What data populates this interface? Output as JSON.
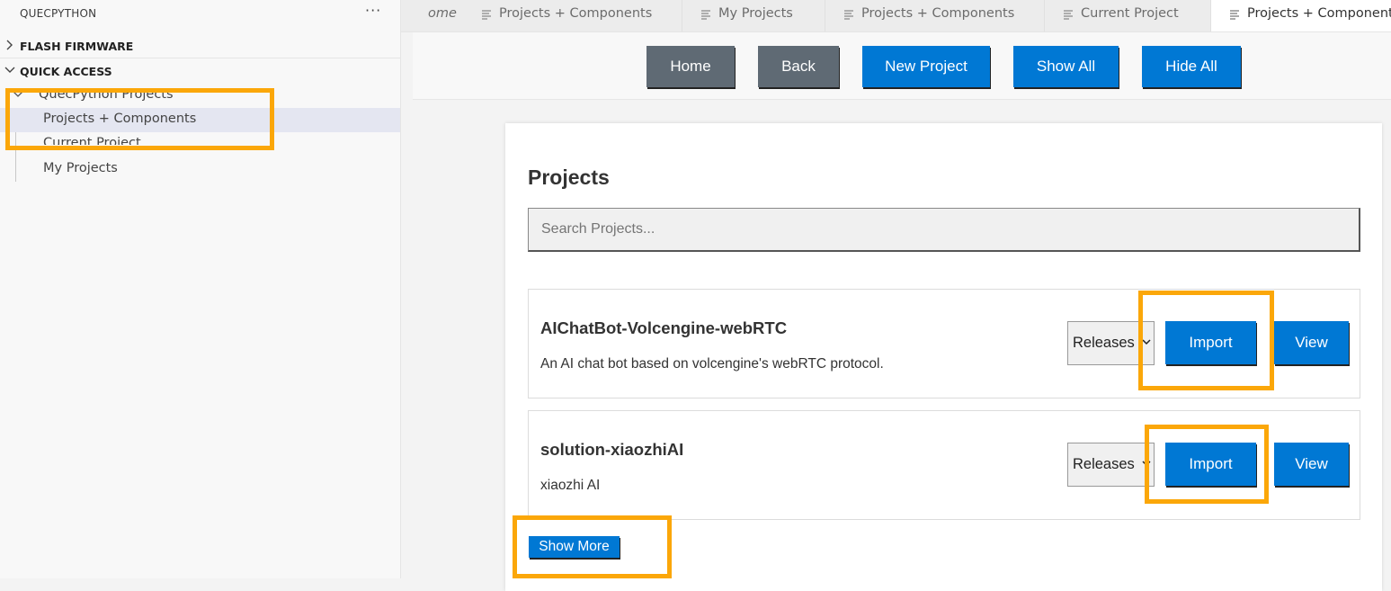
{
  "sidebar": {
    "title": "QUECPYTHON",
    "more": "···",
    "sections": [
      {
        "label": "FLASH FIRMWARE",
        "expanded": false
      },
      {
        "label": "QUICK ACCESS",
        "expanded": true
      }
    ],
    "tree": {
      "group": "QuecPython Projects",
      "items": [
        {
          "label": "Projects + Components",
          "selected": true
        },
        {
          "label": "Current Project",
          "selected": false
        },
        {
          "label": "My Projects",
          "selected": false
        }
      ]
    }
  },
  "tabs": [
    {
      "label": "ome",
      "icon": "document-lines-icon",
      "active": false
    },
    {
      "label": "Projects + Components",
      "icon": "document-lines-icon",
      "active": false
    },
    {
      "label": "My Projects",
      "icon": "document-lines-icon",
      "active": false
    },
    {
      "label": "Projects + Components",
      "icon": "document-lines-icon",
      "active": false
    },
    {
      "label": "Current Project",
      "icon": "document-lines-icon",
      "active": false
    },
    {
      "label": "Projects + Component",
      "icon": "document-lines-icon",
      "active": true
    }
  ],
  "toolbar": {
    "home": "Home",
    "back": "Back",
    "new_project": "New Project",
    "show_all": "Show All",
    "hide_all": "Hide All"
  },
  "projects_panel": {
    "title": "Projects",
    "search_placeholder": "Search Projects...",
    "items": [
      {
        "name": "AIChatBot-Volcengine-webRTC",
        "description": "An AI chat bot based on volcengine's webRTC protocol.",
        "releases_label": "Releases",
        "import_label": "Import",
        "view_label": "View"
      },
      {
        "name": "solution-xiaozhiAI",
        "description": "xiaozhi AI",
        "releases_label": "Releases",
        "import_label": "Import",
        "view_label": "View"
      }
    ],
    "show_more": "Show More"
  },
  "colors": {
    "accent_blue": "#0078d4",
    "gray_button": "#5f6a74",
    "highlight_orange": "#fba709",
    "selected_row": "#e4e6f1"
  }
}
